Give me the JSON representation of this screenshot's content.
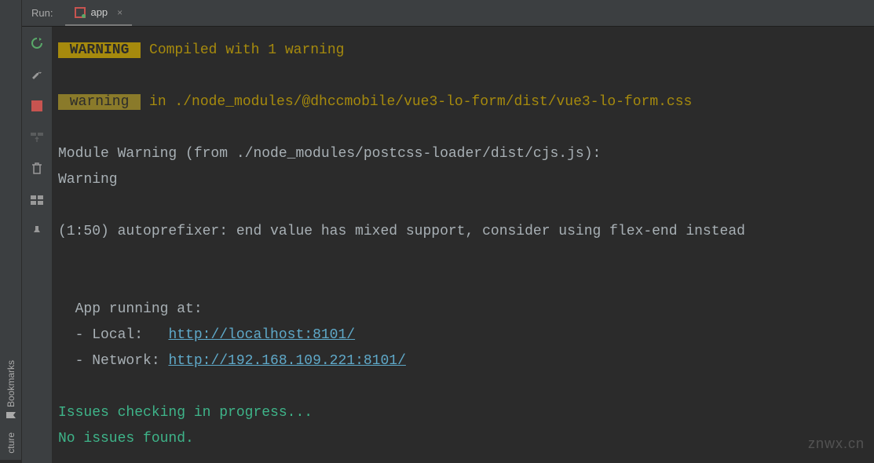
{
  "top": {
    "run_label": "Run:",
    "tab_name": "app",
    "close": "×"
  },
  "rail": {
    "bookmarks": "Bookmarks",
    "structure": "cture"
  },
  "console": {
    "warning_badge": " WARNING ",
    "compiled": " Compiled with 1 warning",
    "warning_lc": " warning ",
    "in_path": " in ./node_modules/@dhccmobile/vue3-lo-form/dist/vue3-lo-form.css",
    "module_warning": "Module Warning (from ./node_modules/postcss-loader/dist/cjs.js):",
    "warning_text": "Warning",
    "autoprefixer": "(1:50) autoprefixer: end value has mixed support, consider using flex-end instead",
    "running_at": "  App running at:",
    "local_label": "  - Local:   ",
    "local_url": "http://localhost:8101/",
    "network_label": "  - Network: ",
    "network_url": "http://192.168.109.221:8101/",
    "issues_checking": "Issues checking in progress...",
    "no_issues": "No issues found."
  },
  "watermark": "znwx.cn"
}
